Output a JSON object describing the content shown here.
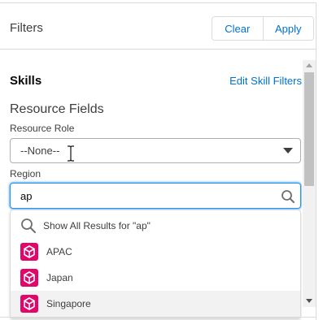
{
  "header": {
    "title": "Filters",
    "clear_label": "Clear",
    "apply_label": "Apply"
  },
  "skills": {
    "title": "Skills",
    "edit_link": "Edit Skill Filters"
  },
  "resource_fields": {
    "title": "Resource Fields",
    "role_label": "Resource Role",
    "role_value": "--None--",
    "region_label": "Region",
    "region_value": "ap"
  },
  "dropdown": {
    "show_all": "Show All Results for \"ap\"",
    "options": [
      "APAC",
      "Japan",
      "Singapore"
    ],
    "highlighted": "Singapore"
  },
  "colors": {
    "accent": "#0070d2",
    "focus_border": "#1b96ff",
    "territory_icon": "#e3066a",
    "hover_bg": "#f3f2f2"
  },
  "icons": {
    "search": "search-icon",
    "option": "territory-icon",
    "select": "chevron-down-icon"
  }
}
